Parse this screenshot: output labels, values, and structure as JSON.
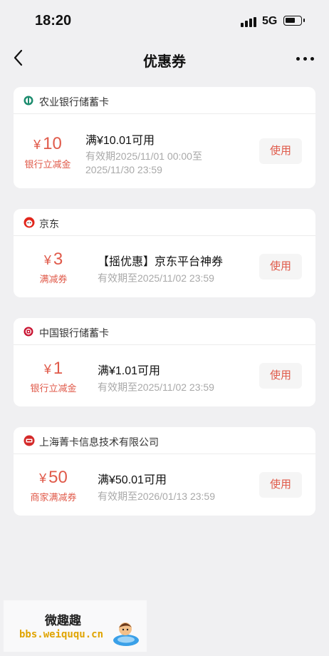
{
  "status": {
    "time": "18:20",
    "network": "5G"
  },
  "nav": {
    "title": "优惠券"
  },
  "coupons": [
    {
      "issuer": "农业银行储蓄卡",
      "issuer_icon": "abc-bank-logo-icon",
      "currency": "¥",
      "amount": "10",
      "type": "银行立减金",
      "title": "满¥10.01可用",
      "validity": "有效期2025/11/01 00:00至 2025/11/30 23:59",
      "button": "使用"
    },
    {
      "issuer": "京东",
      "issuer_icon": "jd-logo-icon",
      "currency": "¥",
      "amount": "3",
      "type": "满减券",
      "title": "【摇优惠】京东平台神券",
      "validity": "有效期至2025/11/02 23:59",
      "button": "使用"
    },
    {
      "issuer": "中国银行储蓄卡",
      "issuer_icon": "boc-bank-logo-icon",
      "currency": "¥",
      "amount": "1",
      "type": "银行立减金",
      "title": "满¥1.01可用",
      "validity": "有效期至2025/11/02 23:59",
      "button": "使用"
    },
    {
      "issuer": "上海菁卡信息技术有限公司",
      "issuer_icon": "merchant-logo-icon",
      "currency": "¥",
      "amount": "50",
      "type": "商家满减券",
      "title": "满¥50.01可用",
      "validity": "有效期至2026/01/13 23:59",
      "button": "使用"
    }
  ],
  "watermark": {
    "title": "微趣趣",
    "url": "bbs.weiququ.cn"
  },
  "colors": {
    "accent": "#e05a4a",
    "abc_green": "#1c8c6e",
    "red_logo": "#d42a2a",
    "background": "#f0f0f2"
  }
}
